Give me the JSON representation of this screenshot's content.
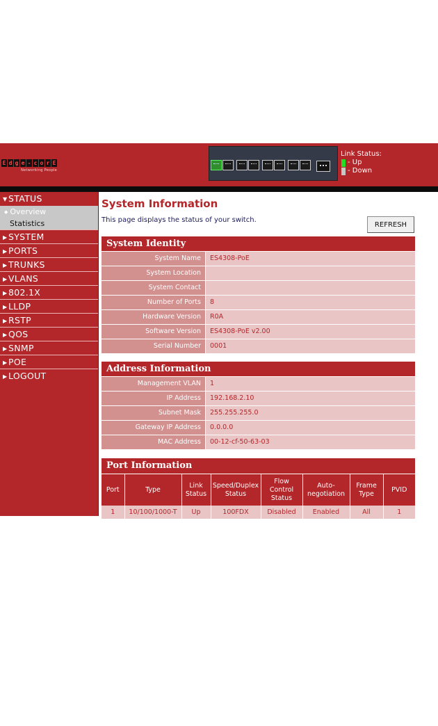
{
  "header": {
    "logo_text": "Edge-core",
    "logo_letters": [
      "E",
      "d",
      "g",
      "e",
      "-",
      "c",
      "o",
      "r",
      "E"
    ],
    "logo_tagline": "Networking People",
    "link_status_title": "Link Status:",
    "legend_up": "- Up",
    "legend_down": "- Down",
    "colors": {
      "up": "#22dd22",
      "down": "#c8c8c8",
      "brand": "#b3262a"
    }
  },
  "sidebar": {
    "items": [
      {
        "label": "STATUS",
        "expanded": true,
        "icon": "triangle-down-icon"
      },
      {
        "label": "SYSTEM",
        "icon": "triangle-right-icon"
      },
      {
        "label": "PORTS",
        "icon": "triangle-right-icon"
      },
      {
        "label": "TRUNKS",
        "icon": "triangle-right-icon"
      },
      {
        "label": "VLANS",
        "icon": "triangle-right-icon"
      },
      {
        "label": "802.1X",
        "icon": "triangle-right-icon"
      },
      {
        "label": "LLDP",
        "icon": "triangle-right-icon"
      },
      {
        "label": "RSTP",
        "icon": "triangle-right-icon"
      },
      {
        "label": "QOS",
        "icon": "triangle-right-icon"
      },
      {
        "label": "SNMP",
        "icon": "triangle-right-icon"
      },
      {
        "label": "POE",
        "icon": "triangle-right-icon"
      },
      {
        "label": "LOGOUT",
        "icon": "triangle-right-icon"
      }
    ],
    "status_sub": [
      {
        "label": "Overview",
        "active": true
      },
      {
        "label": "Statistics",
        "active": false
      }
    ]
  },
  "main": {
    "title": "System Information",
    "description": "This page displays the status of your switch.",
    "refresh_label": "REFRESH",
    "system_identity": {
      "title": "System Identity",
      "rows": [
        {
          "label": "System Name",
          "value": "ES4308-PoE"
        },
        {
          "label": "System Location",
          "value": ""
        },
        {
          "label": "System Contact",
          "value": ""
        },
        {
          "label": "Number of Ports",
          "value": "8"
        },
        {
          "label": "Hardware Version",
          "value": "R0A"
        },
        {
          "label": "Software Version",
          "value": "ES4308-PoE v2.00"
        },
        {
          "label": "Serial Number",
          "value": "0001"
        }
      ]
    },
    "address_info": {
      "title": "Address Information",
      "rows": [
        {
          "label": "Management VLAN",
          "value": "1"
        },
        {
          "label": "IP Address",
          "value": "192.168.2.10"
        },
        {
          "label": "Subnet Mask",
          "value": "255.255.255.0"
        },
        {
          "label": "Gateway IP Address",
          "value": "0.0.0.0"
        },
        {
          "label": "MAC Address",
          "value": "00-12-cf-50-63-03"
        }
      ]
    },
    "port_info": {
      "title": "Port Information",
      "headers": [
        [
          "Port"
        ],
        [
          "Type"
        ],
        [
          "Link",
          "Status"
        ],
        [
          "Speed/Duplex",
          "Status"
        ],
        [
          "Flow",
          "Control",
          "Status"
        ],
        [
          "Auto-",
          "negotiation"
        ],
        [
          "Frame",
          "Type"
        ],
        [
          "PVID"
        ]
      ],
      "rows": [
        [
          "1",
          "10/100/1000-T",
          "Up",
          "100FDX",
          "Disabled",
          "Enabled",
          "All",
          "1"
        ]
      ]
    }
  }
}
